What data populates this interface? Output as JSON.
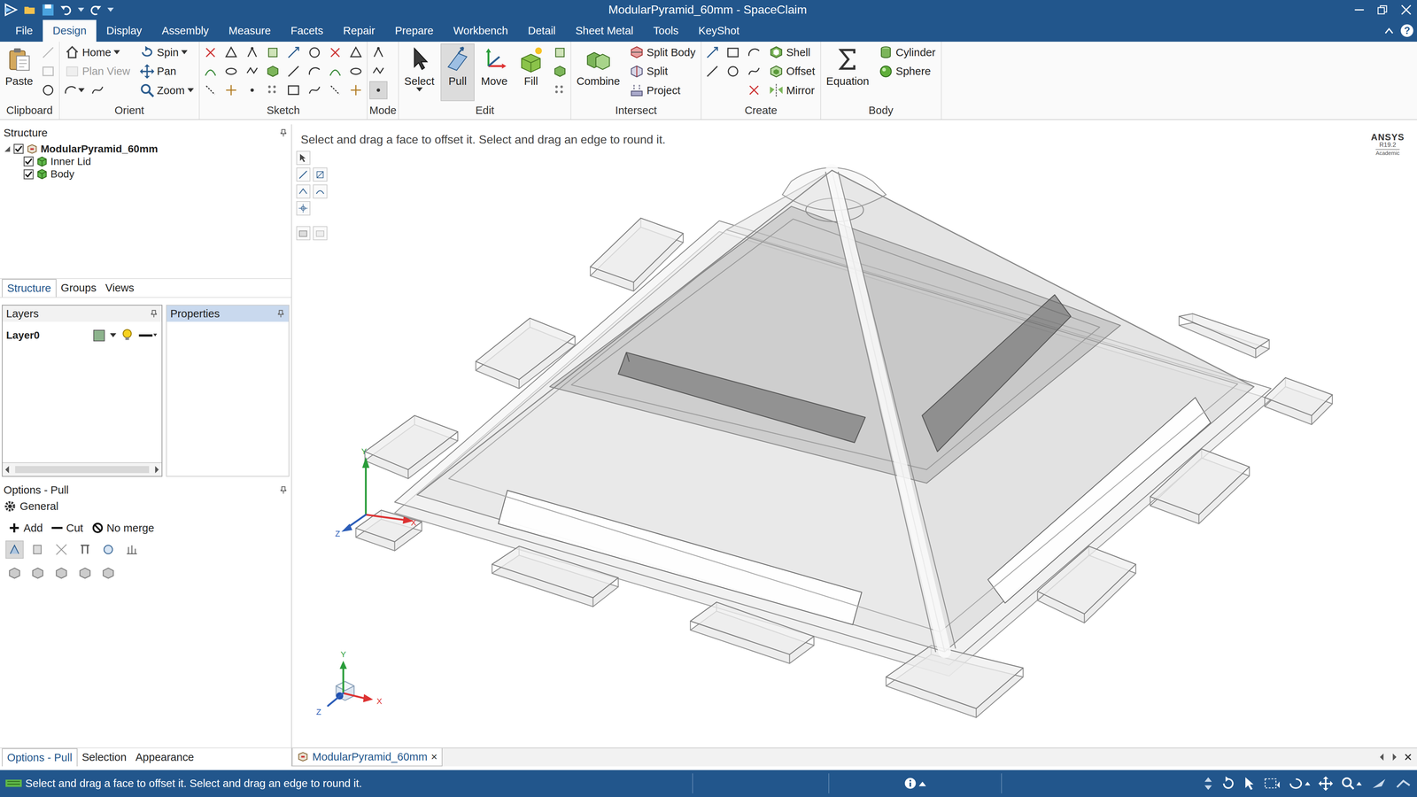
{
  "window": {
    "title": "ModularPyramid_60mm - SpaceClaim"
  },
  "ribbon_tabs": [
    {
      "label": "File",
      "selected": false
    },
    {
      "label": "Design",
      "selected": true
    },
    {
      "label": "Display",
      "selected": false
    },
    {
      "label": "Assembly",
      "selected": false
    },
    {
      "label": "Measure",
      "selected": false
    },
    {
      "label": "Facets",
      "selected": false
    },
    {
      "label": "Repair",
      "selected": false
    },
    {
      "label": "Prepare",
      "selected": false
    },
    {
      "label": "Workbench",
      "selected": false
    },
    {
      "label": "Detail",
      "selected": false
    },
    {
      "label": "Sheet Metal",
      "selected": false
    },
    {
      "label": "Tools",
      "selected": false
    },
    {
      "label": "KeyShot",
      "selected": false
    }
  ],
  "help": "?",
  "ribbon_groups": [
    {
      "label": "Clipboard",
      "columns": [
        [
          [
            {
              "kind": "large",
              "label": "Paste",
              "dropdown": false,
              "selected": false,
              "disabled": false
            }
          ]
        ],
        [
          [
            {
              "kind": "icon",
              "dropdown": false,
              "selected": false,
              "disabled": true
            }
          ],
          [
            {
              "kind": "icon",
              "dropdown": false,
              "selected": false,
              "disabled": true
            }
          ],
          [
            {
              "kind": "icon",
              "dropdown": false,
              "selected": false,
              "disabled": false
            }
          ]
        ]
      ]
    },
    {
      "label": "Orient",
      "columns": [
        [
          [
            {
              "kind": "small",
              "label": "Home",
              "dropdown": true,
              "selected": false,
              "disabled": false
            }
          ],
          [
            {
              "kind": "small",
              "label": "Plan View",
              "dropdown": false,
              "selected": false,
              "disabled": true
            }
          ],
          [
            {
              "kind": "icon",
              "dropdown": true,
              "selected": false,
              "disabled": false
            },
            {
              "kind": "icon",
              "dropdown": false,
              "selected": false,
              "disabled": false
            }
          ]
        ],
        [
          [
            {
              "kind": "small",
              "label": "Spin",
              "dropdown": true,
              "selected": false,
              "disabled": false
            }
          ],
          [
            {
              "kind": "small",
              "label": "Pan",
              "dropdown": false,
              "selected": false,
              "disabled": false
            }
          ],
          [
            {
              "kind": "small",
              "label": "Zoom",
              "dropdown": true,
              "selected": false,
              "disabled": false
            }
          ]
        ]
      ]
    },
    {
      "label": "Sketch",
      "columns": [
        [
          [
            {
              "kind": "icon",
              "dropdown": false,
              "selected": false,
              "disabled": false
            }
          ],
          [
            {
              "kind": "icon",
              "dropdown": false,
              "selected": false,
              "disabled": false
            }
          ],
          [
            {
              "kind": "icon",
              "dropdown": false,
              "selected": false,
              "disabled": false
            }
          ]
        ],
        [
          [
            {
              "kind": "icon",
              "dropdown": false,
              "selected": false,
              "disabled": false
            }
          ],
          [
            {
              "kind": "icon",
              "dropdown": false,
              "selected": false,
              "disabled": false
            }
          ],
          [
            {
              "kind": "icon",
              "dropdown": false,
              "selected": false,
              "disabled": false
            }
          ]
        ],
        [
          [
            {
              "kind": "icon",
              "dropdown": false,
              "selected": false,
              "disabled": false
            }
          ],
          [
            {
              "kind": "icon",
              "dropdown": false,
              "selected": false,
              "disabled": false
            }
          ],
          [
            {
              "kind": "icon",
              "dropdown": false,
              "selected": false,
              "disabled": false
            }
          ]
        ],
        [
          [
            {
              "kind": "icon",
              "dropdown": false,
              "selected": false,
              "disabled": false
            }
          ],
          [
            {
              "kind": "icon",
              "dropdown": false,
              "selected": false,
              "disabled": false
            }
          ],
          [
            {
              "kind": "icon",
              "dropdown": false,
              "selected": false,
              "disabled": false
            }
          ]
        ],
        [
          [
            {
              "kind": "icon",
              "dropdown": false,
              "selected": false,
              "disabled": false
            }
          ],
          [
            {
              "kind": "icon",
              "dropdown": false,
              "selected": false,
              "disabled": false
            }
          ],
          [
            {
              "kind": "icon",
              "dropdown": false,
              "selected": false,
              "disabled": false
            }
          ]
        ],
        [
          [
            {
              "kind": "icon",
              "dropdown": false,
              "selected": false,
              "disabled": false
            }
          ],
          [
            {
              "kind": "icon",
              "dropdown": false,
              "selected": false,
              "disabled": false
            }
          ],
          [
            {
              "kind": "icon",
              "dropdown": false,
              "selected": false,
              "disabled": false
            }
          ]
        ],
        [
          [
            {
              "kind": "icon",
              "dropdown": false,
              "selected": false,
              "disabled": false
            }
          ],
          [
            {
              "kind": "icon",
              "dropdown": false,
              "selected": false,
              "disabled": false
            }
          ],
          [
            {
              "kind": "icon",
              "dropdown": false,
              "selected": false,
              "disabled": false
            }
          ]
        ],
        [
          [
            {
              "kind": "icon",
              "dropdown": false,
              "selected": false,
              "disabled": false
            }
          ],
          [
            {
              "kind": "icon",
              "dropdown": false,
              "selected": false,
              "disabled": false
            }
          ],
          [
            {
              "kind": "icon",
              "dropdown": false,
              "selected": false,
              "disabled": false
            }
          ]
        ]
      ]
    },
    {
      "label": "Mode",
      "columns": [
        [
          [
            {
              "kind": "icon",
              "dropdown": false,
              "selected": false,
              "disabled": false
            }
          ],
          [
            {
              "kind": "icon",
              "dropdown": false,
              "selected": false,
              "disabled": false
            }
          ],
          [
            {
              "kind": "icon",
              "dropdown": false,
              "selected": true,
              "disabled": false
            }
          ]
        ]
      ]
    },
    {
      "label": "Edit",
      "columns": [
        [
          [
            {
              "kind": "large",
              "label": "Select",
              "dropdown": true,
              "selected": false,
              "disabled": false
            }
          ]
        ],
        [
          [
            {
              "kind": "large",
              "label": "Pull",
              "dropdown": false,
              "selected": true,
              "disabled": false
            }
          ]
        ],
        [
          [
            {
              "kind": "large",
              "label": "Move",
              "dropdown": false,
              "selected": false,
              "disabled": false
            }
          ]
        ],
        [
          [
            {
              "kind": "large",
              "label": "Fill",
              "dropdown": false,
              "selected": false,
              "disabled": false
            }
          ]
        ],
        [
          [
            {
              "kind": "icon",
              "dropdown": false,
              "selected": false,
              "disabled": false
            }
          ],
          [
            {
              "kind": "icon",
              "dropdown": false,
              "selected": false,
              "disabled": false
            }
          ],
          [
            {
              "kind": "icon",
              "dropdown": false,
              "selected": false,
              "disabled": false
            }
          ]
        ]
      ]
    },
    {
      "label": "Intersect",
      "columns": [
        [
          [
            {
              "kind": "large",
              "label": "Combine",
              "dropdown": false,
              "selected": false,
              "disabled": false
            }
          ]
        ],
        [
          [
            {
              "kind": "small",
              "label": "Split Body",
              "dropdown": false,
              "selected": false,
              "disabled": false
            }
          ],
          [
            {
              "kind": "small",
              "label": "Split",
              "dropdown": false,
              "selected": false,
              "disabled": false
            }
          ],
          [
            {
              "kind": "small",
              "label": "Project",
              "dropdown": false,
              "selected": false,
              "disabled": false
            }
          ]
        ]
      ]
    },
    {
      "label": "Create",
      "columns": [
        [
          [
            {
              "kind": "icon",
              "dropdown": false,
              "selected": false,
              "disabled": false
            }
          ],
          [
            {
              "kind": "icon",
              "dropdown": false,
              "selected": false,
              "disabled": false
            }
          ]
        ],
        [
          [
            {
              "kind": "icon",
              "dropdown": false,
              "selected": false,
              "disabled": false
            }
          ],
          [
            {
              "kind": "icon",
              "dropdown": false,
              "selected": false,
              "disabled": false
            }
          ]
        ],
        [
          [
            {
              "kind": "icon",
              "dropdown": false,
              "selected": false,
              "disabled": false
            }
          ],
          [
            {
              "kind": "icon",
              "dropdown": false,
              "selected": false,
              "disabled": false
            }
          ],
          [
            {
              "kind": "icon",
              "dropdown": false,
              "selected": false,
              "disabled": false
            }
          ]
        ],
        [
          [
            {
              "kind": "small",
              "label": "Shell",
              "dropdown": false,
              "selected": false,
              "disabled": false
            }
          ],
          [
            {
              "kind": "small",
              "label": "Offset",
              "dropdown": false,
              "selected": false,
              "disabled": false
            }
          ],
          [
            {
              "kind": "small",
              "label": "Mirror",
              "dropdown": false,
              "selected": false,
              "disabled": false
            }
          ]
        ]
      ]
    },
    {
      "label": "Body",
      "columns": [
        [
          [
            {
              "kind": "large",
              "label": "Equation",
              "dropdown": false,
              "selected": false,
              "disabled": false
            }
          ]
        ],
        [
          [
            {
              "kind": "small",
              "label": "Cylinder",
              "dropdown": false,
              "selected": false,
              "disabled": false
            }
          ],
          [
            {
              "kind": "small",
              "label": "Sphere",
              "dropdown": false,
              "selected": false,
              "disabled": false
            }
          ]
        ]
      ]
    }
  ],
  "structure": {
    "title": "Structure",
    "root": {
      "label": "ModularPyramid_60mm",
      "expanded": true,
      "checked": true
    },
    "children": [
      {
        "label": "Inner Lid",
        "checked": true
      },
      {
        "label": "Body",
        "checked": true
      }
    ]
  },
  "panel_tabs": [
    {
      "label": "Structure",
      "selected": true
    },
    {
      "label": "Groups",
      "selected": false
    },
    {
      "label": "Views",
      "selected": false
    }
  ],
  "layers": {
    "title": "Layers",
    "rows": [
      {
        "name": "Layer0",
        "color": "#8db38d",
        "visible": true
      }
    ]
  },
  "properties": {
    "title": "Properties"
  },
  "options": {
    "title": "Options - Pull",
    "section": "General",
    "modes": [
      {
        "label": "Add"
      },
      {
        "label": "Cut"
      },
      {
        "label": "No merge"
      }
    ],
    "tool_rows": [
      [
        {
          "selected": true
        },
        {
          "selected": false
        },
        {
          "selected": false
        },
        {
          "selected": false
        },
        {
          "selected": false
        },
        {
          "selected": false
        }
      ],
      [
        {
          "selected": false
        },
        {
          "selected": false
        },
        {
          "selected": false
        },
        {
          "selected": false
        },
        {
          "selected": false
        }
      ]
    ]
  },
  "bottom_tabs": [
    {
      "label": "Options - Pull",
      "selected": true
    },
    {
      "label": "Selection",
      "selected": false
    },
    {
      "label": "Appearance",
      "selected": false
    }
  ],
  "viewport": {
    "prompt": "Select and drag a face to offset it. Select and drag an edge to round it.",
    "logo": {
      "brand": "ANSYS",
      "version": "R19.2",
      "edition": "Academic"
    },
    "triad": {
      "x": "X",
      "y": "Y",
      "z": "Z"
    },
    "cube": {
      "x": "X",
      "y": "Y",
      "z": "Z"
    }
  },
  "document_tabs": [
    {
      "label": "ModularPyramid_60mm",
      "close": "×",
      "selected": true
    }
  ],
  "status_bar": {
    "message": "Select and drag a face to offset it. Select and drag an edge to round it."
  }
}
